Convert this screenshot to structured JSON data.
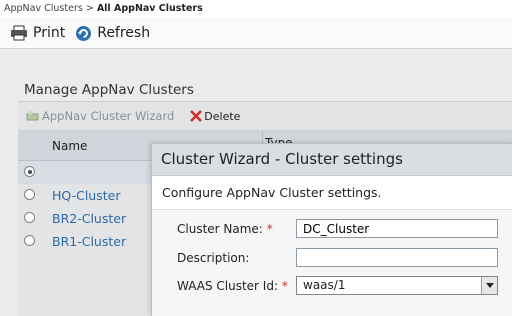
{
  "breadcrumb": {
    "parent": "AppNav Clusters",
    "separator": " > ",
    "current": "All AppNav Clusters"
  },
  "toolbar": {
    "print_label": "Print",
    "refresh_label": "Refresh"
  },
  "section": {
    "title": "Manage AppNav Clusters"
  },
  "panel_toolbar": {
    "wizard_label": "AppNav Cluster Wizard",
    "delete_label": "Delete"
  },
  "table": {
    "columns": [
      "Name",
      "Type"
    ],
    "rows": [
      {
        "name": "",
        "selected": true
      },
      {
        "name": "HQ-Cluster",
        "selected": false
      },
      {
        "name": "BR2-Cluster",
        "selected": false
      },
      {
        "name": "BR1-Cluster",
        "selected": false
      }
    ]
  },
  "dialog": {
    "title": "Cluster Wizard - Cluster settings",
    "subtitle": "Configure AppNav Cluster settings.",
    "fields": {
      "cluster_name_label": "Cluster Name:",
      "cluster_name_value": "DC_Cluster",
      "description_label": "Description:",
      "description_value": "",
      "cluster_id_label": "WAAS Cluster Id:",
      "cluster_id_value": "waas/1",
      "required_marker": "*"
    }
  },
  "colors": {
    "link": "#2f6aa6",
    "required": "#d0302a",
    "delete_x": "#d0302a"
  }
}
